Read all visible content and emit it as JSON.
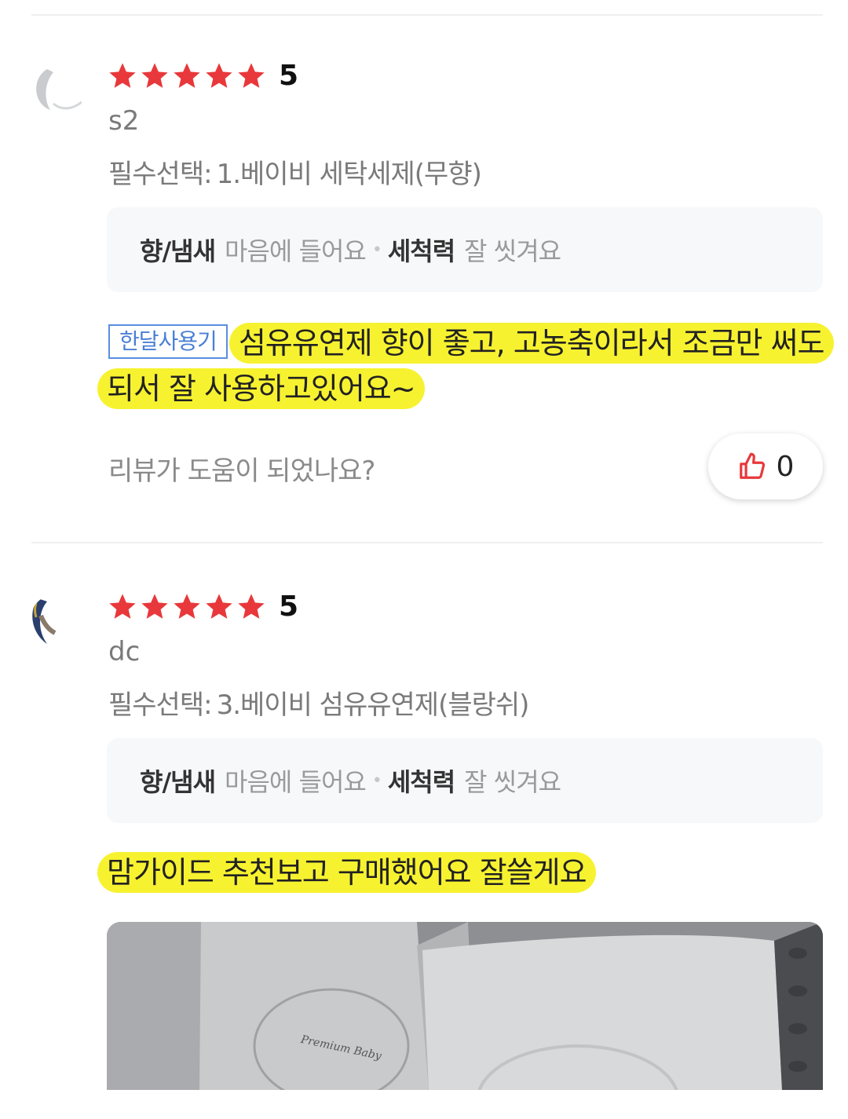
{
  "reviews": [
    {
      "rating_value": 5,
      "rating": "5",
      "username": "s2",
      "option_label": "필수선택:",
      "option_value": "1.베이비 세탁세제(무향)",
      "attributes": [
        {
          "key": "향/냄새",
          "value": "마음에 들어요"
        },
        {
          "key": "세척력",
          "value": "잘 씻겨요"
        }
      ],
      "badge": "한달사용기",
      "text": "섬유유연제 향이 좋고, 고농축이라서 조금만 써도 되서 잘 사용하고있어요~",
      "helpful_question": "리뷰가 도움이 되었나요?",
      "like_count": "0"
    },
    {
      "rating_value": 5,
      "rating": "5",
      "username": "dc",
      "option_label": "필수선택:",
      "option_value": "3.베이비 섬유유연제(블랑쉬)",
      "attributes": [
        {
          "key": "향/냄새",
          "value": "마음에 들어요"
        },
        {
          "key": "세척력",
          "value": "잘 씻겨요"
        }
      ],
      "text": "맘가이드 추천보고 구매했어요 잘쓸게요",
      "photo_label": "Premium Baby"
    }
  ],
  "colors": {
    "star": "#e8383b",
    "highlight": "#f7f230",
    "badge": "#4a7fd6",
    "like_icon": "#e8383b"
  }
}
